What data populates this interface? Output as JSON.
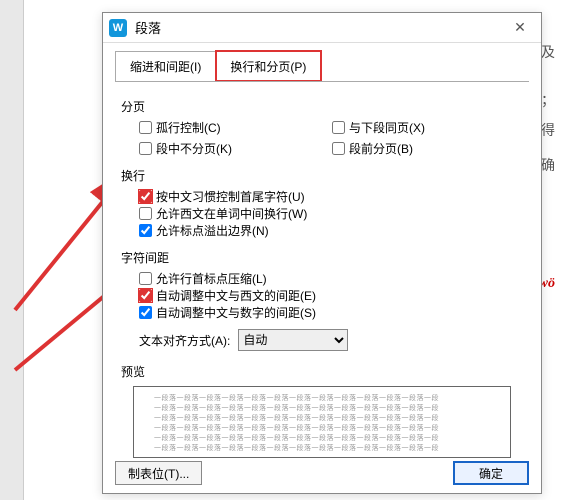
{
  "titlebar": {
    "app_icon_letter": "W",
    "title": "段落"
  },
  "tabs": {
    "indent": "缩进和间距(I)",
    "pagination": "换行和分页(P)"
  },
  "sections": {
    "page": "分页",
    "wrap": "换行",
    "spacing": "字符间距",
    "preview": "预览"
  },
  "options": {
    "widow": "孤行控制(C)",
    "keep_with_next": "与下段同页(X)",
    "no_break": "段中不分页(K)",
    "break_before": "段前分页(B)",
    "cjk_first_last": "按中文习惯控制首尾字符(U)",
    "latin_wrap": "允许西文在单词中间换行(W)",
    "hang_punct": "允许标点溢出边界(N)",
    "compress_first": "允许行首标点压缩(L)",
    "auto_cjk_latin": "自动调整中文与西文的间距(E)",
    "auto_cjk_num": "自动调整中文与数字的间距(S)"
  },
  "align": {
    "label": "文本对齐方式(A):",
    "value": "自动"
  },
  "preview_line": "一段落一段落一段落一段落一段落一段落一段落一段落一段落一段落一段落一段落一段",
  "footer": {
    "tabs_btn": "制表位(T)...",
    "ok": "确定"
  },
  "bg_text": {
    "l1": "欠及",
    "l2": "I；",
    "l3": "不得",
    "l4": "斗确",
    "l5": "wö"
  }
}
